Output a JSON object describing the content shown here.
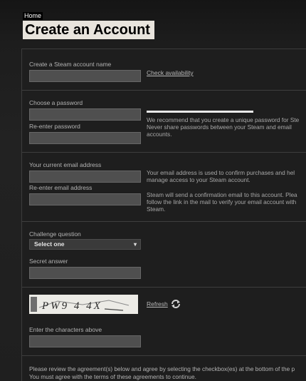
{
  "breadcrumb": {
    "home": "Home"
  },
  "page_title": "Create an Account",
  "account": {
    "name_label": "Create a Steam account name",
    "check_availability": "Check availability"
  },
  "password": {
    "choose_label": "Choose a password",
    "reenter_label": "Re-enter password",
    "recommend_line1": "We recommend that you create a unique password for Ste",
    "recommend_line2": "Never share passwords between your Steam and email",
    "recommend_line3": "accounts."
  },
  "email": {
    "current_label": "Your current email address",
    "reenter_label": "Re-enter email address",
    "info_line1": "Your email address is used to confirm purchases and hel",
    "info_line2": "manage access to your Steam account.",
    "confirm_line1": "Steam will send a confirmation email to this account. Plea",
    "confirm_line2": "follow the link in the mail to verify your email account with",
    "confirm_line3": "Steam."
  },
  "challenge": {
    "question_label": "Challenge question",
    "selected": "Select one",
    "answer_label": "Secret answer"
  },
  "captcha": {
    "text": "PW9 4 4X",
    "refresh": "Refresh",
    "enter_label": "Enter the characters above"
  },
  "agreement": {
    "line1": "Please review the agreement(s) below and agree by selecting the checkbox(es) at the bottom of the p",
    "line2": "You must agree with the terms of these agreements to continue."
  },
  "colors": {
    "background": "#1e1e1e",
    "field": "#4f4f4f",
    "title_bg": "#e8e4dd",
    "label": "#b3b3b3"
  },
  "icons": {
    "refresh": "refresh-arrows-icon",
    "dropdown": "chevron-down-icon"
  }
}
